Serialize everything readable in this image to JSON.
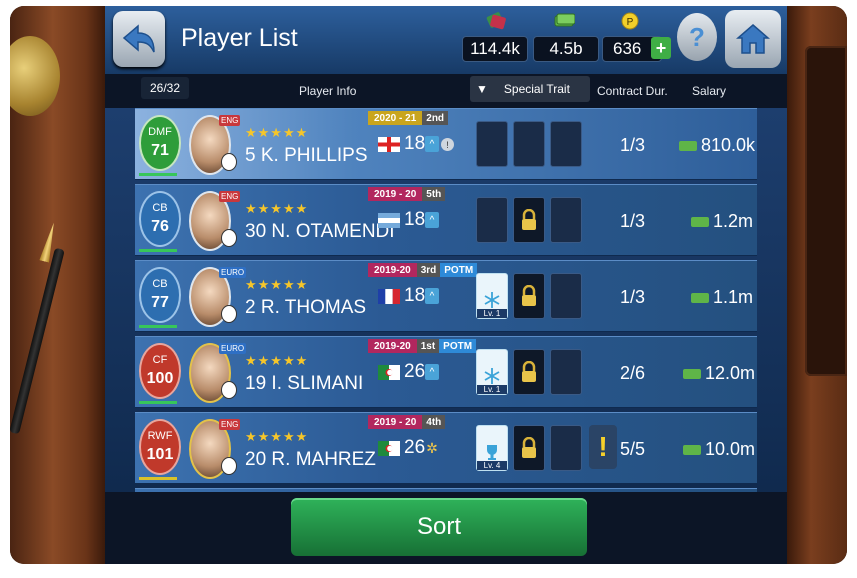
{
  "header": {
    "title": "Player List",
    "resources": [
      {
        "icon": "tickets-icon",
        "value": "114.4k"
      },
      {
        "icon": "cash-icon",
        "value": "4.5b"
      },
      {
        "icon": "points-icon",
        "value": "636"
      }
    ],
    "help_label": "?"
  },
  "columns": {
    "count": "26/32",
    "player_info": "Player Info",
    "special_trait": "Special Trait",
    "contract": "Contract Dur.",
    "salary": "Salary"
  },
  "players": [
    {
      "position": "DMF",
      "position_color": "#2e9d3a",
      "ovr": "71",
      "tag": "ENG",
      "tag_color": "#c8383c",
      "stars": "★★★★★",
      "name": "5 K. PHILLIPS",
      "season": "2020 - 21",
      "season_color": "#c9a51e",
      "rank": "2nd",
      "potm": "",
      "flag": "england",
      "age": "18",
      "contract": "1/3",
      "salary": "810.0k"
    },
    {
      "position": "CB",
      "position_color": "#2d6eb0",
      "ovr": "76",
      "tag": "ENG",
      "tag_color": "#c8383c",
      "stars": "★★★★★",
      "name": "30 N. OTAMENDI",
      "season": "2019 - 20",
      "season_color": "#b2275e",
      "rank": "5th",
      "potm": "",
      "flag": "argentina",
      "age": "18",
      "contract": "1/3",
      "salary": "1.2m"
    },
    {
      "position": "CB",
      "position_color": "#2d6eb0",
      "ovr": "77",
      "tag": "EURO",
      "tag_color": "#2e6fc4",
      "stars": "★★★★★",
      "name": "2 R. THOMAS",
      "season": "2019-20",
      "season_color": "#b2275e",
      "rank": "3rd",
      "potm": "POTM",
      "flag": "france",
      "age": "18",
      "contract": "1/3",
      "salary": "1.1m"
    },
    {
      "position": "CF",
      "position_color": "#c0392b",
      "ovr": "100",
      "tag": "EURO",
      "tag_color": "#2e6fc4",
      "stars": "★★★★★",
      "name": "19 I. SLIMANI",
      "season": "2019-20",
      "season_color": "#b2275e",
      "rank": "1st",
      "potm": "POTM",
      "flag": "algeria",
      "age": "26",
      "contract": "2/6",
      "salary": "12.0m"
    },
    {
      "position": "RWF",
      "position_color": "#c0392b",
      "ovr": "101",
      "tag": "ENG",
      "tag_color": "#c8383c",
      "stars": "★★★★★",
      "name": "20 R. MAHREZ",
      "season": "2019 - 20",
      "season_color": "#b2275e",
      "rank": "4th",
      "potm": "",
      "flag": "algeria",
      "age": "26",
      "contract": "5/5",
      "salary": "10.0m"
    }
  ],
  "traits": {
    "row3_level": "Lv. 1",
    "row4_level": "Lv. 1",
    "row5_level": "Lv. 4"
  },
  "alert_mark": "!",
  "sort_label": "Sort"
}
